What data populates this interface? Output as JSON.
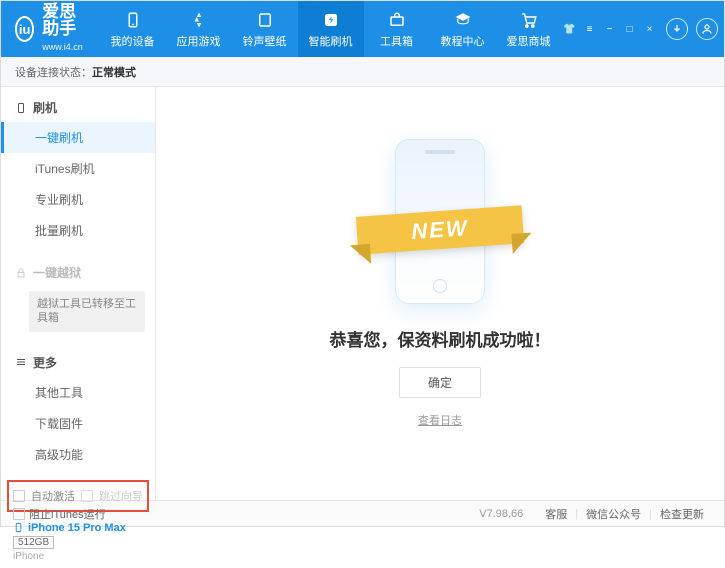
{
  "header": {
    "logo_text": "爱思助手",
    "logo_sub": "www.i4.cn",
    "nav": [
      {
        "label": "我的设备"
      },
      {
        "label": "应用游戏"
      },
      {
        "label": "铃声壁纸"
      },
      {
        "label": "智能刷机"
      },
      {
        "label": "工具箱"
      },
      {
        "label": "教程中心"
      },
      {
        "label": "爱思商城"
      }
    ]
  },
  "status": {
    "prefix": "设备连接状态：",
    "mode": "正常模式"
  },
  "sidebar": {
    "sec1": {
      "head": "刷机",
      "items": [
        "一键刷机",
        "iTunes刷机",
        "专业刷机",
        "批量刷机"
      ]
    },
    "sec2": {
      "head": "一键越狱",
      "box": "越狱工具已转移至工具箱"
    },
    "sec3": {
      "head": "更多",
      "items": [
        "其他工具",
        "下载固件",
        "高级功能"
      ]
    },
    "checks": {
      "c1": "自动激活",
      "c2": "跳过向导"
    },
    "device": {
      "name": "iPhone 15 Pro Max",
      "storage": "512GB",
      "type": "iPhone"
    }
  },
  "content": {
    "ribbon": "NEW",
    "msg": "恭喜您，保资料刷机成功啦！",
    "ok": "确定",
    "log": "查看日志"
  },
  "footer": {
    "block_itunes": "阻止iTunes运行",
    "version": "V7.98.66",
    "links": [
      "客服",
      "微信公众号",
      "检查更新"
    ]
  }
}
